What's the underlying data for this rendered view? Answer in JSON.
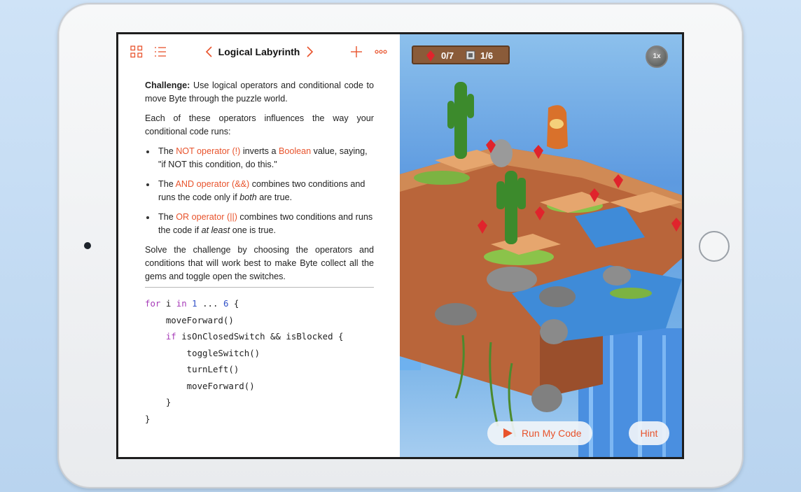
{
  "nav": {
    "title": "Logical Labyrinth",
    "icons": [
      "grid-icon",
      "list-icon",
      "chevron-left-icon",
      "chevron-right-icon",
      "plus-icon",
      "more-icon"
    ]
  },
  "content": {
    "challenge_label": "Challenge:",
    "challenge_text": " Use logical operators and conditional code to move Byte through the puzzle world.",
    "intro": "Each of these operators influences the way your conditional code runs:",
    "bullet1": {
      "pre": "The ",
      "link": "NOT operator (!)",
      "mid": " inverts a ",
      "link2": "Boolean",
      "post": " value, saying, \"if NOT this condition, do this.\""
    },
    "bullet2": {
      "pre": "The ",
      "link": "AND operator (&&)",
      "mid": " combines two conditions and runs the code only if ",
      "em": "both",
      "post": " are true."
    },
    "bullet3": {
      "pre": "The ",
      "link": "OR operator (||)",
      "mid": " combines two conditions and runs the code if ",
      "em": "at least",
      "post": " one is true."
    },
    "solve": "Solve the challenge by choosing the operators and conditions that will work best to make Byte collect all the gems and toggle open the switches."
  },
  "code": {
    "l1_kw": "for",
    "l1_a": " i ",
    "l1_kw2": "in",
    "l1_b": " ",
    "l1_n1": "1",
    "l1_c": " ... ",
    "l1_n2": "6",
    "l1_d": " {",
    "l2": "    moveForward()",
    "l3_pre": "    ",
    "l3_kw": "if",
    "l3_rest": " isOnClosedSwitch && isBlocked {",
    "l4": "        toggleSwitch()",
    "l5": "        turnLeft()",
    "l6": "        moveForward()",
    "l7": "    }",
    "l8": "}"
  },
  "game": {
    "gems": "0/7",
    "switches": "1/6",
    "speed": "1x",
    "run_label": "Run My Code",
    "hint_label": "Hint"
  },
  "colors": {
    "accent": "#e8532c",
    "keyword": "#a63ab8",
    "number": "#2f4fc7"
  }
}
